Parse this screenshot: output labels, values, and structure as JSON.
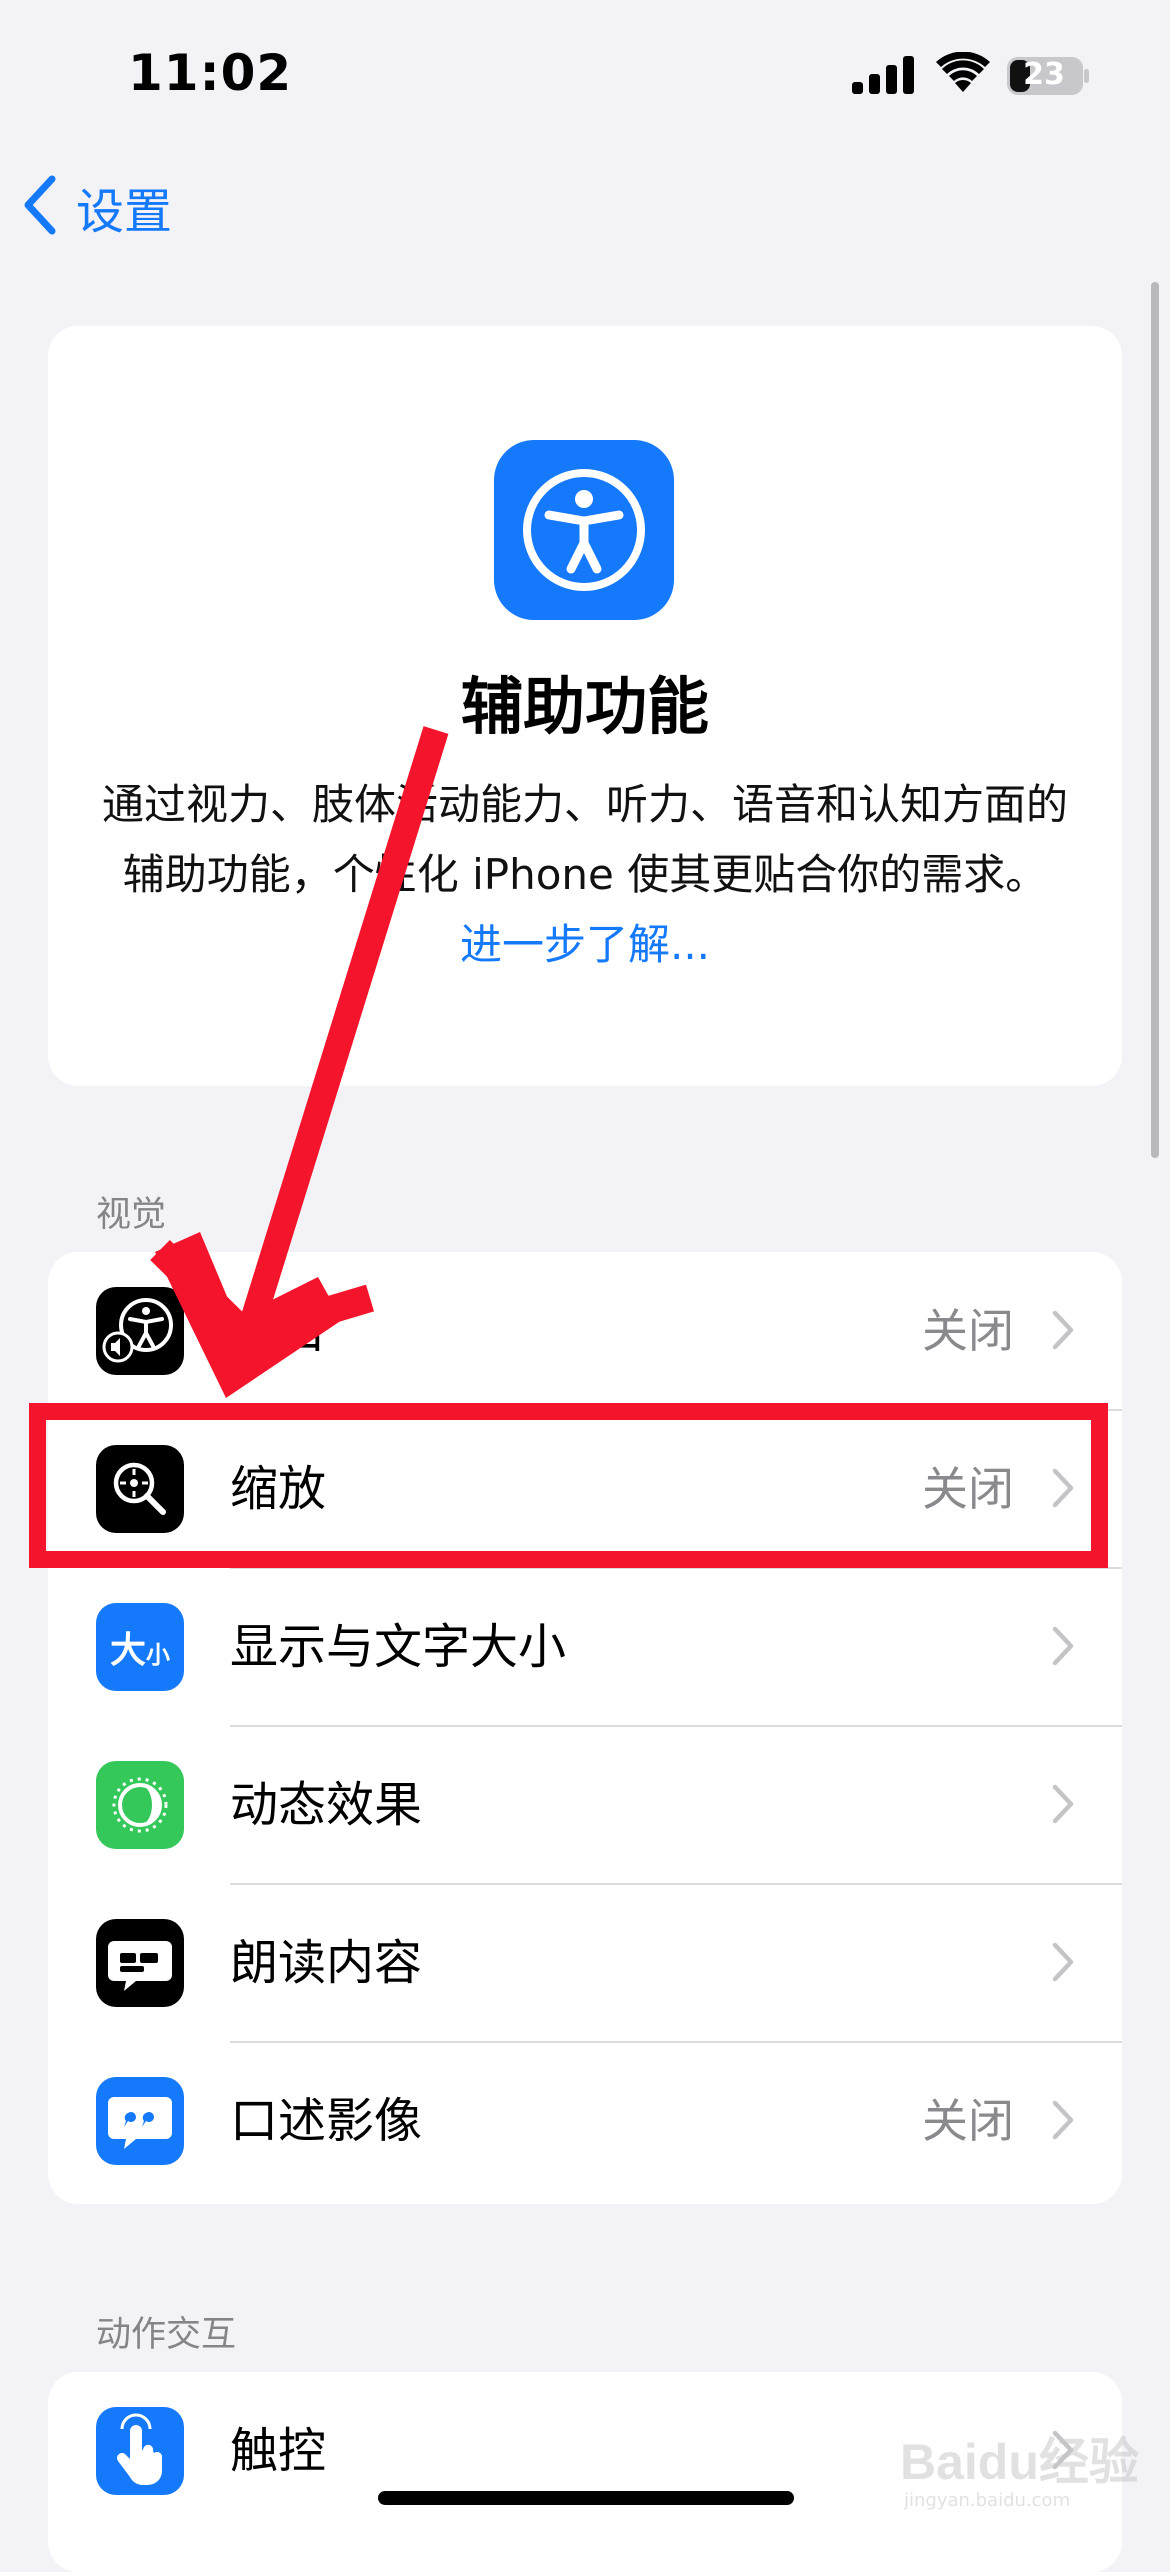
{
  "status_bar": {
    "time": "11:02",
    "battery": "23"
  },
  "nav": {
    "back_label": "设置"
  },
  "hero": {
    "title": "辅助功能",
    "description": "通过视力、肢体活动能力、听力、语音和认知方面的辅助功能，个性化 iPhone 使其更贴合你的需求。",
    "link_label": "进一步了解..."
  },
  "sections": [
    {
      "header": "视觉",
      "rows": [
        {
          "icon": "voiceover-icon",
          "label": "旁白",
          "value": "关闭"
        },
        {
          "icon": "zoom-icon",
          "label": "缩放",
          "value": "关闭"
        },
        {
          "icon": "display-text-size-icon",
          "label": "显示与文字大小",
          "value": ""
        },
        {
          "icon": "motion-icon",
          "label": "动态效果",
          "value": ""
        },
        {
          "icon": "spoken-content-icon",
          "label": "朗读内容",
          "value": ""
        },
        {
          "icon": "audio-descriptions-icon",
          "label": "口述影像",
          "value": "关闭"
        }
      ]
    },
    {
      "header": "动作交互",
      "rows": [
        {
          "icon": "touch-icon",
          "label": "触控",
          "value": ""
        }
      ]
    }
  ],
  "icon_glyphs": {
    "display_text_size": "大",
    "display_text_size_small": "小"
  },
  "watermark": {
    "brand": "Baidu经验",
    "site": "jingyan.baidu.com"
  },
  "colors": {
    "accent": "#1479fb",
    "annotation": "#f4142b",
    "background": "#f2f2f7",
    "motion_green": "#34c759"
  }
}
